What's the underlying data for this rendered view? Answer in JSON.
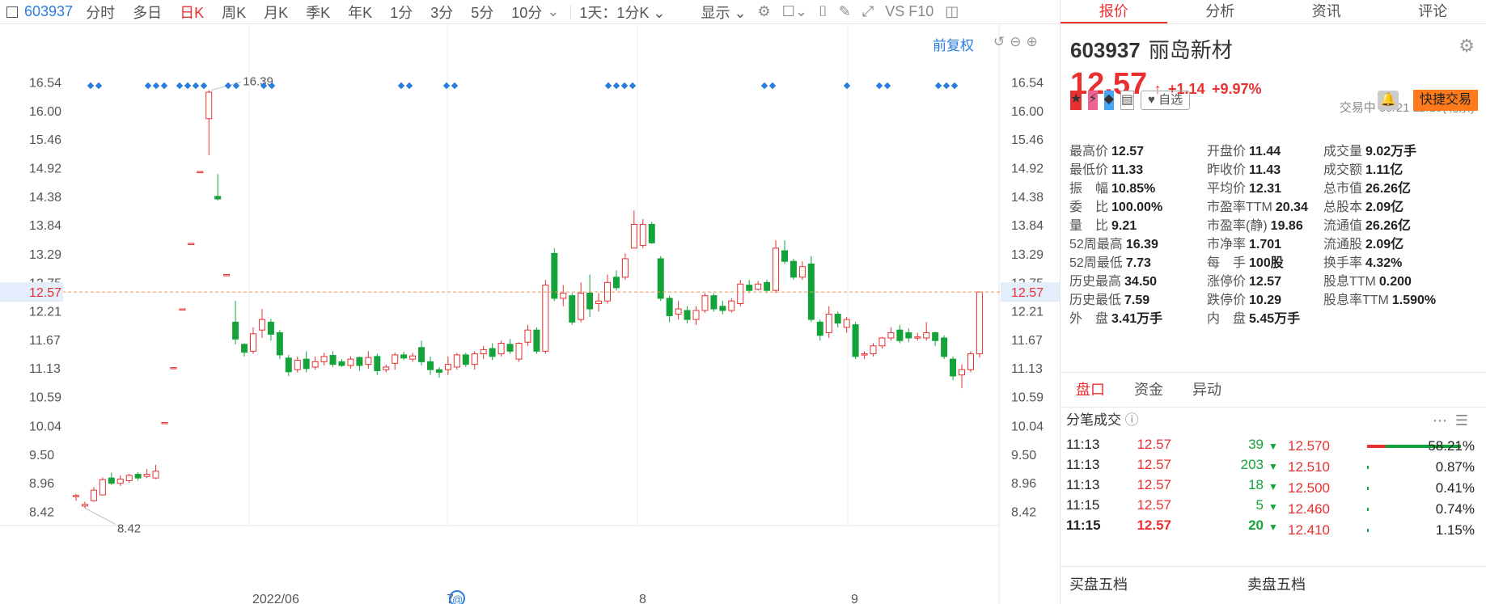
{
  "toolbar": {
    "code": "603937",
    "tabs": [
      "分时",
      "多日",
      "日K",
      "周K",
      "月K",
      "季K",
      "年K",
      "1分",
      "3分",
      "5分",
      "10分"
    ],
    "active_tab": "日K",
    "period_select": "1天：1分K",
    "display_select": "显示",
    "extra": "VS F10"
  },
  "chart": {
    "fq_label": "前复权",
    "y_ticks": [
      "16.54",
      "16.00",
      "15.46",
      "14.92",
      "14.38",
      "13.84",
      "13.29",
      "12.75",
      "12.21",
      "11.67",
      "11.13",
      "10.59",
      "10.04",
      "9.50",
      "8.96",
      "8.42"
    ],
    "current_price_tag": "12.57",
    "x_labels": [
      "2022/06",
      "7",
      "8",
      "9"
    ],
    "high_marker": "16.39",
    "low_marker": "8.42",
    "colors": {
      "up": "#e93030",
      "down": "#14a33a",
      "marker": "#2b7de0"
    }
  },
  "chart_data": {
    "type": "candlestick",
    "title": "",
    "ylim": [
      8.15,
      16.81
    ],
    "x_categories": [
      "2022/06",
      "7",
      "8",
      "9"
    ],
    "ohlc": [
      [
        8.7,
        8.72,
        8.62,
        8.75
      ],
      [
        8.52,
        8.55,
        8.48,
        8.6
      ],
      [
        8.62,
        8.82,
        8.6,
        8.88
      ],
      [
        8.73,
        9.02,
        8.72,
        9.06
      ],
      [
        9.05,
        8.95,
        8.92,
        9.15
      ],
      [
        8.95,
        9.03,
        8.9,
        9.1
      ],
      [
        9.0,
        9.1,
        8.96,
        9.13
      ],
      [
        9.12,
        9.05,
        9.0,
        9.16
      ],
      [
        9.08,
        9.12,
        9.05,
        9.22
      ],
      [
        9.05,
        9.18,
        9.03,
        9.3
      ],
      [
        10.1,
        10.1,
        10.1,
        10.1
      ],
      [
        11.14,
        11.14,
        11.14,
        11.14
      ],
      [
        12.25,
        12.25,
        12.25,
        12.25
      ],
      [
        13.49,
        13.49,
        13.49,
        13.49
      ],
      [
        14.85,
        14.85,
        14.85,
        14.85
      ],
      [
        15.85,
        16.35,
        15.16,
        16.39
      ],
      [
        14.38,
        14.33,
        14.3,
        14.8
      ],
      [
        12.9,
        12.9,
        12.9,
        12.9
      ],
      [
        12.0,
        11.68,
        11.58,
        12.4
      ],
      [
        11.58,
        11.43,
        11.35,
        11.6
      ],
      [
        11.45,
        11.78,
        11.4,
        11.9
      ],
      [
        11.85,
        12.05,
        11.7,
        12.25
      ],
      [
        12.0,
        11.77,
        11.65,
        12.06
      ],
      [
        11.8,
        11.38,
        11.3,
        11.85
      ],
      [
        11.32,
        11.06,
        10.98,
        11.38
      ],
      [
        11.1,
        11.28,
        11.05,
        11.35
      ],
      [
        11.3,
        11.12,
        11.05,
        11.45
      ],
      [
        11.15,
        11.25,
        11.1,
        11.35
      ],
      [
        11.25,
        11.35,
        11.18,
        11.42
      ],
      [
        11.37,
        11.2,
        11.15,
        11.45
      ],
      [
        11.25,
        11.18,
        11.15,
        11.3
      ],
      [
        11.18,
        11.3,
        11.12,
        11.35
      ],
      [
        11.33,
        11.18,
        11.08,
        11.35
      ],
      [
        11.2,
        11.33,
        11.12,
        11.45
      ],
      [
        11.35,
        11.08,
        11.0,
        11.4
      ],
      [
        11.1,
        11.15,
        11.05,
        11.2
      ],
      [
        11.22,
        11.38,
        11.1,
        11.42
      ],
      [
        11.38,
        11.32,
        11.28,
        11.44
      ],
      [
        11.3,
        11.36,
        11.25,
        11.42
      ],
      [
        11.52,
        11.25,
        11.18,
        11.65
      ],
      [
        11.25,
        11.1,
        11.0,
        11.35
      ],
      [
        11.1,
        11.05,
        10.95,
        11.15
      ],
      [
        11.1,
        11.2,
        11.0,
        11.35
      ],
      [
        11.15,
        11.38,
        11.1,
        11.42
      ],
      [
        11.38,
        11.2,
        11.15,
        11.42
      ],
      [
        11.2,
        11.4,
        11.1,
        11.45
      ],
      [
        11.4,
        11.48,
        11.3,
        11.55
      ],
      [
        11.5,
        11.35,
        11.28,
        11.6
      ],
      [
        11.4,
        11.6,
        11.35,
        11.65
      ],
      [
        11.58,
        11.45,
        11.4,
        11.68
      ],
      [
        11.3,
        11.6,
        11.25,
        11.62
      ],
      [
        11.62,
        11.85,
        11.55,
        11.95
      ],
      [
        11.85,
        11.45,
        11.4,
        11.9
      ],
      [
        11.45,
        12.7,
        11.4,
        12.8
      ],
      [
        13.3,
        12.45,
        12.4,
        13.4
      ],
      [
        12.45,
        12.55,
        12.3,
        12.7
      ],
      [
        12.5,
        12.0,
        11.95,
        12.55
      ],
      [
        12.05,
        12.55,
        12.0,
        12.75
      ],
      [
        12.55,
        12.25,
        12.1,
        12.9
      ],
      [
        12.35,
        12.4,
        12.2,
        12.55
      ],
      [
        12.4,
        12.75,
        12.35,
        12.9
      ],
      [
        12.85,
        12.65,
        12.6,
        12.98
      ],
      [
        12.85,
        13.2,
        12.8,
        13.3
      ],
      [
        13.4,
        13.85,
        13.4,
        14.11
      ],
      [
        13.45,
        13.85,
        13.4,
        13.95
      ],
      [
        13.85,
        13.5,
        13.48,
        13.9
      ],
      [
        13.2,
        12.45,
        12.4,
        13.25
      ],
      [
        12.45,
        12.12,
        12.0,
        12.5
      ],
      [
        12.15,
        12.25,
        12.05,
        12.4
      ],
      [
        12.22,
        12.05,
        11.98,
        12.3
      ],
      [
        12.05,
        12.22,
        11.95,
        12.3
      ],
      [
        12.22,
        12.5,
        12.18,
        12.55
      ],
      [
        12.5,
        12.25,
        12.2,
        12.55
      ],
      [
        12.3,
        12.22,
        12.15,
        12.4
      ],
      [
        12.22,
        12.4,
        12.18,
        12.45
      ],
      [
        12.35,
        12.72,
        12.3,
        12.8
      ],
      [
        12.7,
        12.6,
        12.55,
        12.8
      ],
      [
        12.62,
        12.72,
        12.6,
        12.78
      ],
      [
        12.75,
        12.6,
        12.55,
        12.8
      ],
      [
        12.6,
        13.4,
        12.55,
        13.55
      ],
      [
        13.35,
        13.15,
        13.1,
        13.55
      ],
      [
        13.15,
        12.85,
        12.8,
        13.2
      ],
      [
        12.85,
        13.05,
        12.8,
        13.15
      ],
      [
        13.1,
        12.05,
        12.0,
        13.25
      ],
      [
        12.0,
        11.75,
        11.65,
        12.05
      ],
      [
        11.8,
        12.15,
        11.7,
        12.3
      ],
      [
        12.15,
        11.98,
        11.9,
        12.2
      ],
      [
        11.9,
        12.05,
        11.8,
        12.1
      ],
      [
        11.95,
        11.35,
        11.3,
        12.0
      ],
      [
        11.38,
        11.4,
        11.3,
        11.45
      ],
      [
        11.4,
        11.55,
        11.35,
        11.6
      ],
      [
        11.55,
        11.7,
        11.5,
        11.72
      ],
      [
        11.7,
        11.8,
        11.65,
        11.9
      ],
      [
        11.85,
        11.65,
        11.6,
        11.95
      ],
      [
        11.8,
        11.7,
        11.62,
        11.88
      ],
      [
        11.7,
        11.72,
        11.65,
        11.8
      ],
      [
        11.7,
        11.8,
        11.65,
        12.0
      ],
      [
        11.8,
        11.65,
        11.55,
        11.82
      ],
      [
        11.7,
        11.35,
        11.3,
        11.75
      ],
      [
        11.3,
        10.98,
        10.9,
        11.35
      ],
      [
        11.0,
        11.1,
        10.75,
        11.2
      ],
      [
        11.1,
        11.4,
        11.05,
        11.45
      ],
      [
        11.4,
        12.57,
        11.33,
        12.57
      ]
    ]
  },
  "panel": {
    "tabs": [
      "报价",
      "分析",
      "资讯",
      "评论"
    ],
    "active_tab": "报价",
    "code": "603937",
    "name": "丽岛新材",
    "price": "12.57",
    "change": "+1.14",
    "change_pct": "+9.97%",
    "status": "交易中 09/21 11:15(北京)",
    "fav_label": "自选",
    "trade_label": "快捷交易"
  },
  "stats": [
    [
      {
        "l": "最高价",
        "v": "12.57",
        "c": "red"
      },
      {
        "l": "开盘价",
        "v": "11.44",
        "c": "red"
      },
      {
        "l": "成交量",
        "v": "9.02万手",
        "c": ""
      }
    ],
    [
      {
        "l": "最低价",
        "v": "11.33",
        "c": "green"
      },
      {
        "l": "昨收价",
        "v": "11.43",
        "c": ""
      },
      {
        "l": "成交额",
        "v": "1.11亿",
        "c": ""
      }
    ],
    [
      {
        "l": "振　幅",
        "v": "10.85%",
        "c": ""
      },
      {
        "l": "平均价",
        "v": "12.31",
        "c": "red"
      },
      {
        "l": "总市值",
        "v": "26.26亿",
        "c": ""
      }
    ],
    [
      {
        "l": "委　比",
        "v": "100.00%",
        "c": ""
      },
      {
        "l": "市盈率TTM",
        "v": "20.34",
        "c": ""
      },
      {
        "l": "总股本",
        "v": "2.09亿",
        "c": ""
      }
    ],
    [
      {
        "l": "量　比",
        "v": "9.21",
        "c": ""
      },
      {
        "l": "市盈率(静)",
        "v": "19.86",
        "c": ""
      },
      {
        "l": "流通值",
        "v": "26.26亿",
        "c": ""
      }
    ],
    [
      {
        "l": "52周最高",
        "v": "16.39",
        "c": "red"
      },
      {
        "l": "市净率",
        "v": "1.701",
        "c": ""
      },
      {
        "l": "流通股",
        "v": "2.09亿",
        "c": ""
      }
    ],
    [
      {
        "l": "52周最低",
        "v": "7.73",
        "c": "green"
      },
      {
        "l": "每　手",
        "v": "100股",
        "c": ""
      },
      {
        "l": "换手率",
        "v": "4.32%",
        "c": ""
      }
    ],
    [
      {
        "l": "历史最高",
        "v": "34.50",
        "c": "red"
      },
      {
        "l": "涨停价",
        "v": "12.57",
        "c": "red"
      },
      {
        "l": "股息TTM",
        "v": "0.200",
        "c": ""
      }
    ],
    [
      {
        "l": "历史最低",
        "v": "7.59",
        "c": "green"
      },
      {
        "l": "跌停价",
        "v": "10.29",
        "c": "green"
      },
      {
        "l": "股息率TTM",
        "v": "1.590%",
        "c": ""
      }
    ],
    [
      {
        "l": "外　盘",
        "v": "3.41万手",
        "c": "red"
      },
      {
        "l": "内　盘",
        "v": "5.45万手",
        "c": "green"
      },
      {
        "l": "",
        "v": "",
        "c": ""
      }
    ]
  ],
  "subtabs": [
    "盘口",
    "资金",
    "异动"
  ],
  "active_subtab": "盘口",
  "trades_title": "分笔成交",
  "trades": [
    {
      "t": "11:13",
      "p": "12.57",
      "v": "39"
    },
    {
      "t": "11:13",
      "p": "12.57",
      "v": "203"
    },
    {
      "t": "11:13",
      "p": "12.57",
      "v": "18"
    },
    {
      "t": "11:15",
      "p": "12.57",
      "v": "5"
    },
    {
      "t": "11:15",
      "p": "12.57",
      "v": "20"
    }
  ],
  "price_levels": [
    {
      "p": "12.570",
      "pct": "58.21%",
      "frac": 0.5821
    },
    {
      "p": "12.510",
      "pct": "0.87%",
      "frac": 0.0087
    },
    {
      "p": "12.500",
      "pct": "0.41%",
      "frac": 0.0041
    },
    {
      "p": "12.460",
      "pct": "0.74%",
      "frac": 0.0074
    },
    {
      "p": "12.410",
      "pct": "1.15%",
      "frac": 0.0115
    }
  ],
  "bottom": {
    "buy": "买盘五档",
    "sell": "卖盘五档"
  }
}
